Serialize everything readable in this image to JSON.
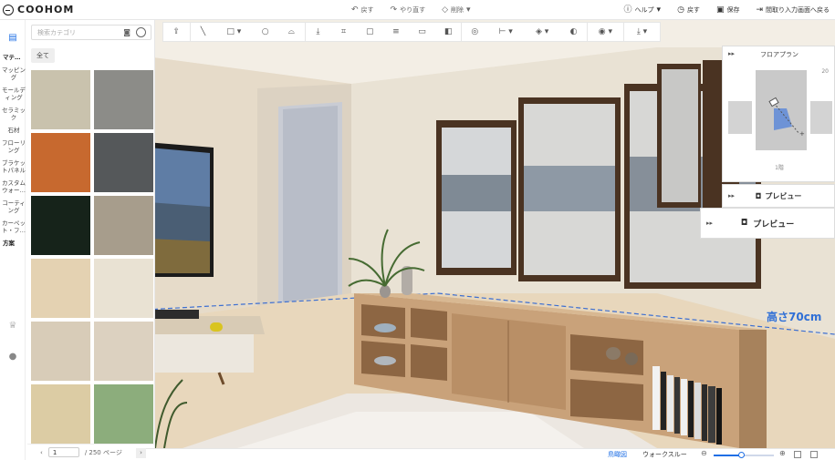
{
  "app": {
    "brand": "COOHOM"
  },
  "topbar": {
    "undo_label": "戻す",
    "redo_label": "やり直す",
    "delete_label": "削除",
    "help_label": "ヘルプ",
    "back_label": "戻す",
    "save_label": "保存",
    "return_label": "間取り入力画面へ戻る"
  },
  "sidebar": {
    "categories": [
      {
        "label": "マテ…",
        "head": true
      },
      {
        "label": "マッピング"
      },
      {
        "label": "モールディング"
      },
      {
        "label": "セラミック"
      },
      {
        "label": "石材"
      },
      {
        "label": "フローリング"
      },
      {
        "label": "ブラケットパネル"
      },
      {
        "label": "カスタムウォー…"
      },
      {
        "label": "コーティング"
      },
      {
        "label": "カーペット・フ…"
      },
      {
        "label": "方案",
        "head": true
      }
    ]
  },
  "materials": {
    "search_placeholder": "検索カテゴリ",
    "filter_chip": "全て",
    "tiles": [
      {
        "name": "wood-grain-light",
        "color": "#c9c2ad"
      },
      {
        "name": "gray-stone",
        "color": "#8c8c88"
      },
      {
        "name": "wooden-baseboard",
        "color": "#c7692f"
      },
      {
        "name": "dark-granite",
        "color": "#55585a"
      },
      {
        "name": "dark-green",
        "color": "#16231a"
      },
      {
        "name": "grey-wood-plank",
        "color": "#a79d8c"
      },
      {
        "name": "beige-marble",
        "color": "#e4d2b2"
      },
      {
        "name": "cream-marble",
        "color": "#e9e2d3"
      },
      {
        "name": "light-wood",
        "color": "#d8ccb8"
      },
      {
        "name": "pale-wood",
        "color": "#dcd1c0"
      },
      {
        "name": "tan-mosaic",
        "color": "#dccca4"
      },
      {
        "name": "green-fabric",
        "color": "#8cad7c"
      }
    ],
    "page_current": "1",
    "page_total": "/ 250 ページ"
  },
  "floorplan": {
    "title": "フロアプラン",
    "scale_label": "20",
    "floor_label": "1階"
  },
  "preview": {
    "label_a": "プレビュー",
    "label_b": "プレビュー"
  },
  "scene": {
    "height_annotation": "高さ70cm"
  },
  "statusbar": {
    "view_mode": "鳥瞰図",
    "walkthrough": "ウォークスルー",
    "zoom_level": 0.45
  }
}
